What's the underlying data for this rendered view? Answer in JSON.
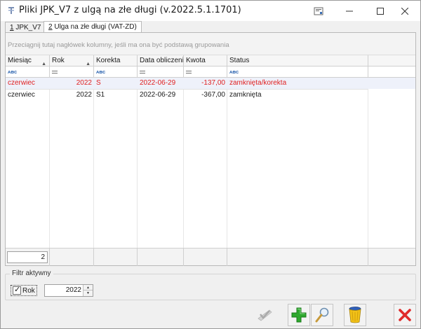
{
  "window": {
    "title": "Pliki JPK_V7 z ulgą na złe długi (v.2022.5.1.1701)"
  },
  "tabs": [
    {
      "accel": "1",
      "label": " JPK_V7"
    },
    {
      "accel": "2",
      "label": " Ulga na złe długi (VAT-ZD)"
    }
  ],
  "grid": {
    "group_hint": "Przeciągnij tutaj nagłówek kolumny, jeśli ma ona być podstawą grupowania",
    "columns": [
      "Miesiąc",
      "Rok",
      "Korekta",
      "Data obliczenia",
      "Kwota",
      "Status"
    ],
    "filter_row_icons": [
      "text-filter-icon",
      "equals-filter-icon",
      "text-filter-icon",
      "equals-filter-icon",
      "equals-filter-icon",
      "text-filter-icon"
    ],
    "filter_text_glyph": "ᴀᴃc",
    "rows": [
      {
        "miesiac": "czerwiec",
        "rok": "2022",
        "korekta": "S",
        "data": "2022-06-29",
        "kwota": "-137,00",
        "status": "zamknięta/korekta",
        "selected": true
      },
      {
        "miesiac": "czerwiec",
        "rok": "2022",
        "korekta": "S1",
        "data": "2022-06-29",
        "kwota": "-367,00",
        "status": "zamknięta",
        "selected": false
      }
    ],
    "footer_count": "2"
  },
  "filter": {
    "legend": "Filtr aktywny",
    "checkbox_label": "Rok",
    "checkbox_checked": true,
    "year_value": "2022"
  },
  "toolbar": {
    "buttons": [
      "approve-icon",
      "add-icon",
      "search-icon",
      "bin-icon",
      "close-icon"
    ]
  },
  "colors": {
    "selected_row_text": "#e02020",
    "selected_row_bg": "#eef1fa",
    "add_green": "#2ea82e",
    "close_red": "#e02a2a"
  }
}
